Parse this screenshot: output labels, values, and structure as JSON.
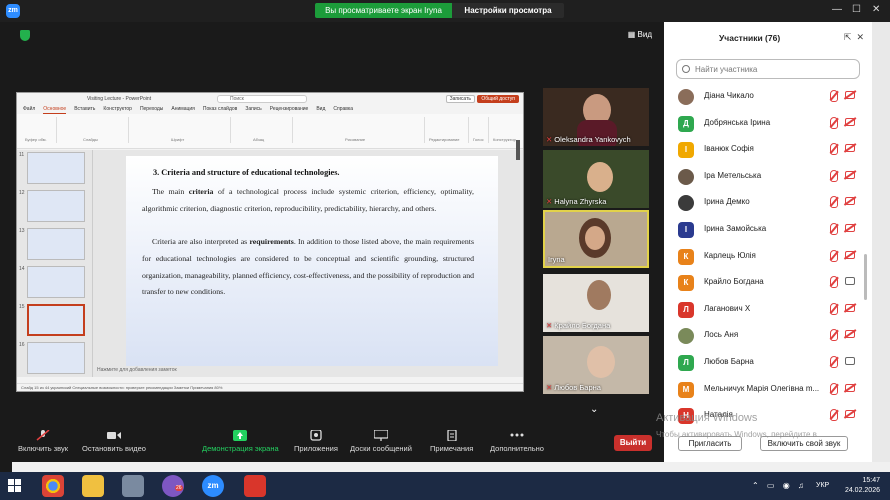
{
  "share_banner": {
    "status": "Вы просматриваете экран Iryna",
    "view_options": "Настройки просмотра"
  },
  "meeting": {
    "view_label": "Вид"
  },
  "ppt": {
    "window_title": "Visiting Lecture - PowerPoint",
    "search_placeholder": "Поиск",
    "menu": [
      "Файл",
      "Основное",
      "Вставить",
      "Конструктор",
      "Переходы",
      "Анимация",
      "Показ слайдов",
      "Запись",
      "Рецензирование",
      "Вид",
      "Справка"
    ],
    "record_label": "Записать",
    "share_label": "Общий доступ",
    "ribbon_groups": [
      "Буфер обм.",
      "Слайды",
      "Шрифт",
      "Абзац",
      "Рисование",
      "Редактирование",
      "Голос",
      "Конструктор"
    ],
    "thumb_numbers": [
      "11",
      "12",
      "13",
      "14",
      "15",
      "16"
    ],
    "slide": {
      "heading": "3. Criteria and structure of educational technologies.",
      "paragraph1": "The main criteria of a technological process include systemic criterion, efficiency, optimality, algorithmic criterion, diagnostic criterion, reproducibility, predictability, hierarchy, and others.",
      "paragraph2": "Criteria are also interpreted as requirements. In addition to those listed above, the main requirements for educational technologies are considered to be conceptual and scientific grounding, structured organization, manageability, planned efficiency, cost-effectiveness, and the possibility of reproduction and transfer to new conditions."
    },
    "notes_placeholder": "Нажмите для добавления заметок",
    "status_bar": "Слайд 15 из 44   украинский   Специальные возможности: проверьте рекомендации   Заметки   Примечания   80%"
  },
  "tiles": [
    {
      "name": "Oleksandra Yankovych",
      "muted": true
    },
    {
      "name": "Halyna Zhyrska",
      "muted": true
    },
    {
      "name": "Iryna",
      "muted": false
    },
    {
      "name": "Крайло Богдана",
      "muted": true
    },
    {
      "name": "Любов Барна",
      "muted": true
    }
  ],
  "toolbar": {
    "mute": "Включить звук",
    "video": "Остановить видео",
    "share": "Демонстрация экрана",
    "apps": "Приложения",
    "whiteboard": "Доски сообщений",
    "notes": "Примечания",
    "more": "Дополнительно",
    "leave": "Выйти"
  },
  "participants": {
    "title": "Участники (76)",
    "search_placeholder": "Найти участника",
    "list": [
      {
        "name": "Діана Чикало",
        "initial": "",
        "color": "#8a6d5a",
        "photo": true,
        "cam": "off"
      },
      {
        "name": "Добрянська Ірина",
        "initial": "Д",
        "color": "#2fa84f",
        "photo": false,
        "cam": "off"
      },
      {
        "name": "Іванюк Софія",
        "initial": "І",
        "color": "#f0a800",
        "photo": false,
        "cam": "off"
      },
      {
        "name": "Іра Метельська",
        "initial": "",
        "color": "#6b5a4a",
        "photo": true,
        "cam": "off"
      },
      {
        "name": "Ірина Демко",
        "initial": "",
        "color": "#3b3b3b",
        "photo": true,
        "cam": "off"
      },
      {
        "name": "Ірина Замойська",
        "initial": "І",
        "color": "#2a3a8f",
        "photo": false,
        "cam": "off"
      },
      {
        "name": "Карлець Юлія",
        "initial": "К",
        "color": "#e8821a",
        "photo": false,
        "cam": "off"
      },
      {
        "name": "Крайло Богдана",
        "initial": "К",
        "color": "#e8821a",
        "photo": false,
        "cam": "on"
      },
      {
        "name": "Лаганович Х",
        "initial": "Л",
        "color": "#d9362b",
        "photo": false,
        "cam": "off"
      },
      {
        "name": "Лось Аня",
        "initial": "",
        "color": "#7a8a5a",
        "photo": true,
        "cam": "off"
      },
      {
        "name": "Любов Барна",
        "initial": "Л",
        "color": "#2fa84f",
        "photo": false,
        "cam": "on"
      },
      {
        "name": "Мельничук Марія Олегівна m...",
        "initial": "М",
        "color": "#e8821a",
        "photo": false,
        "cam": "off"
      },
      {
        "name": "Наталія",
        "initial": "Н",
        "color": "#d9362b",
        "photo": false,
        "cam": "off"
      }
    ],
    "invite": "Пригласить",
    "unmute_self": "Включить свой звук"
  },
  "watermark": {
    "line1": "Активация Windows",
    "line2": "Чтобы активировать Windows, перейдите в"
  },
  "taskbar": {
    "time": "15:47",
    "date": "24.02.2026",
    "lang": "УКР",
    "badge": "26"
  }
}
